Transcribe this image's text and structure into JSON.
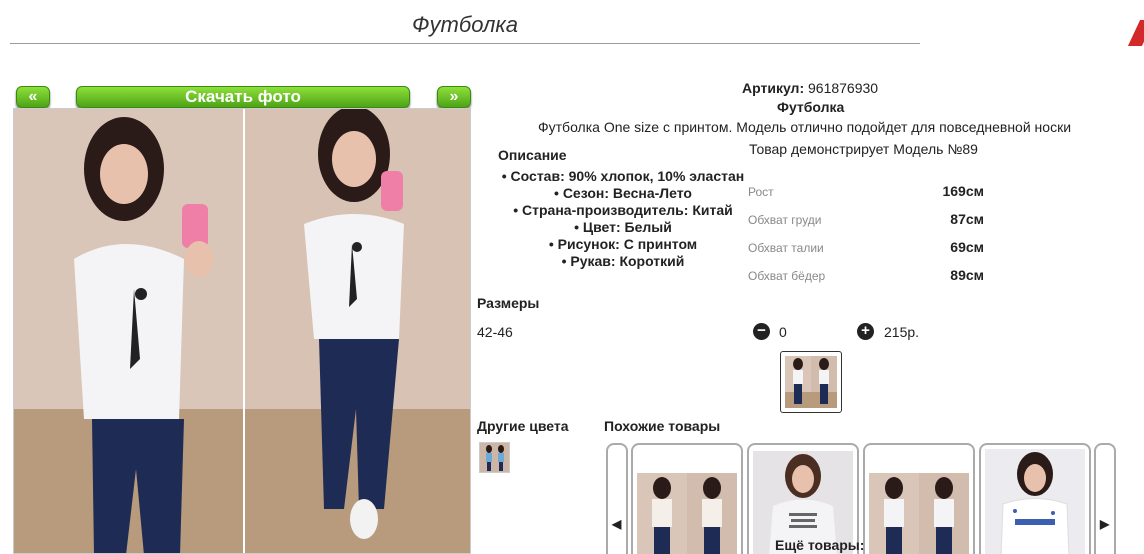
{
  "page": {
    "title": "Футболка"
  },
  "gallery": {
    "prev_label": "«",
    "download_label": "Скачать фото",
    "next_label": "»"
  },
  "product": {
    "article_label": "Артикул:",
    "article_value": "961876930",
    "name": "Футболка",
    "description": "Футболка One size с принтом. Модель отлично подойдет для повседневной носки",
    "model_note": "Товар демонстрирует Модель №89"
  },
  "description_block": {
    "title": "Описание",
    "items": [
      "• Состав: 90% хлопок, 10% эластан",
      "• Сезон: Весна-Лето",
      "• Страна-производитель: Китай",
      "• Цвет: Белый",
      "• Рисунок: С принтом",
      "• Рукав: Короткий"
    ]
  },
  "measurements": [
    {
      "label": "Рост",
      "value": "169см"
    },
    {
      "label": "Обхват груди",
      "value": "87см"
    },
    {
      "label": "Обхват талии",
      "value": "69см"
    },
    {
      "label": "Обхват бёдер",
      "value": "89см"
    }
  ],
  "sizes": {
    "title": "Размеры",
    "range": "42-46",
    "minus_icon": "minus-circle-icon",
    "quantity": "0",
    "plus_icon": "plus-circle-icon",
    "price": "215р."
  },
  "other_colors": {
    "title": "Другие цвета"
  },
  "similar": {
    "title": "Похожие товары",
    "prev_arrow": "◀",
    "next_arrow": "▶",
    "more_label": "Ещё товары:"
  },
  "colors": {
    "accent_green": "#5cb81f",
    "corner_red": "#d22a2a"
  }
}
